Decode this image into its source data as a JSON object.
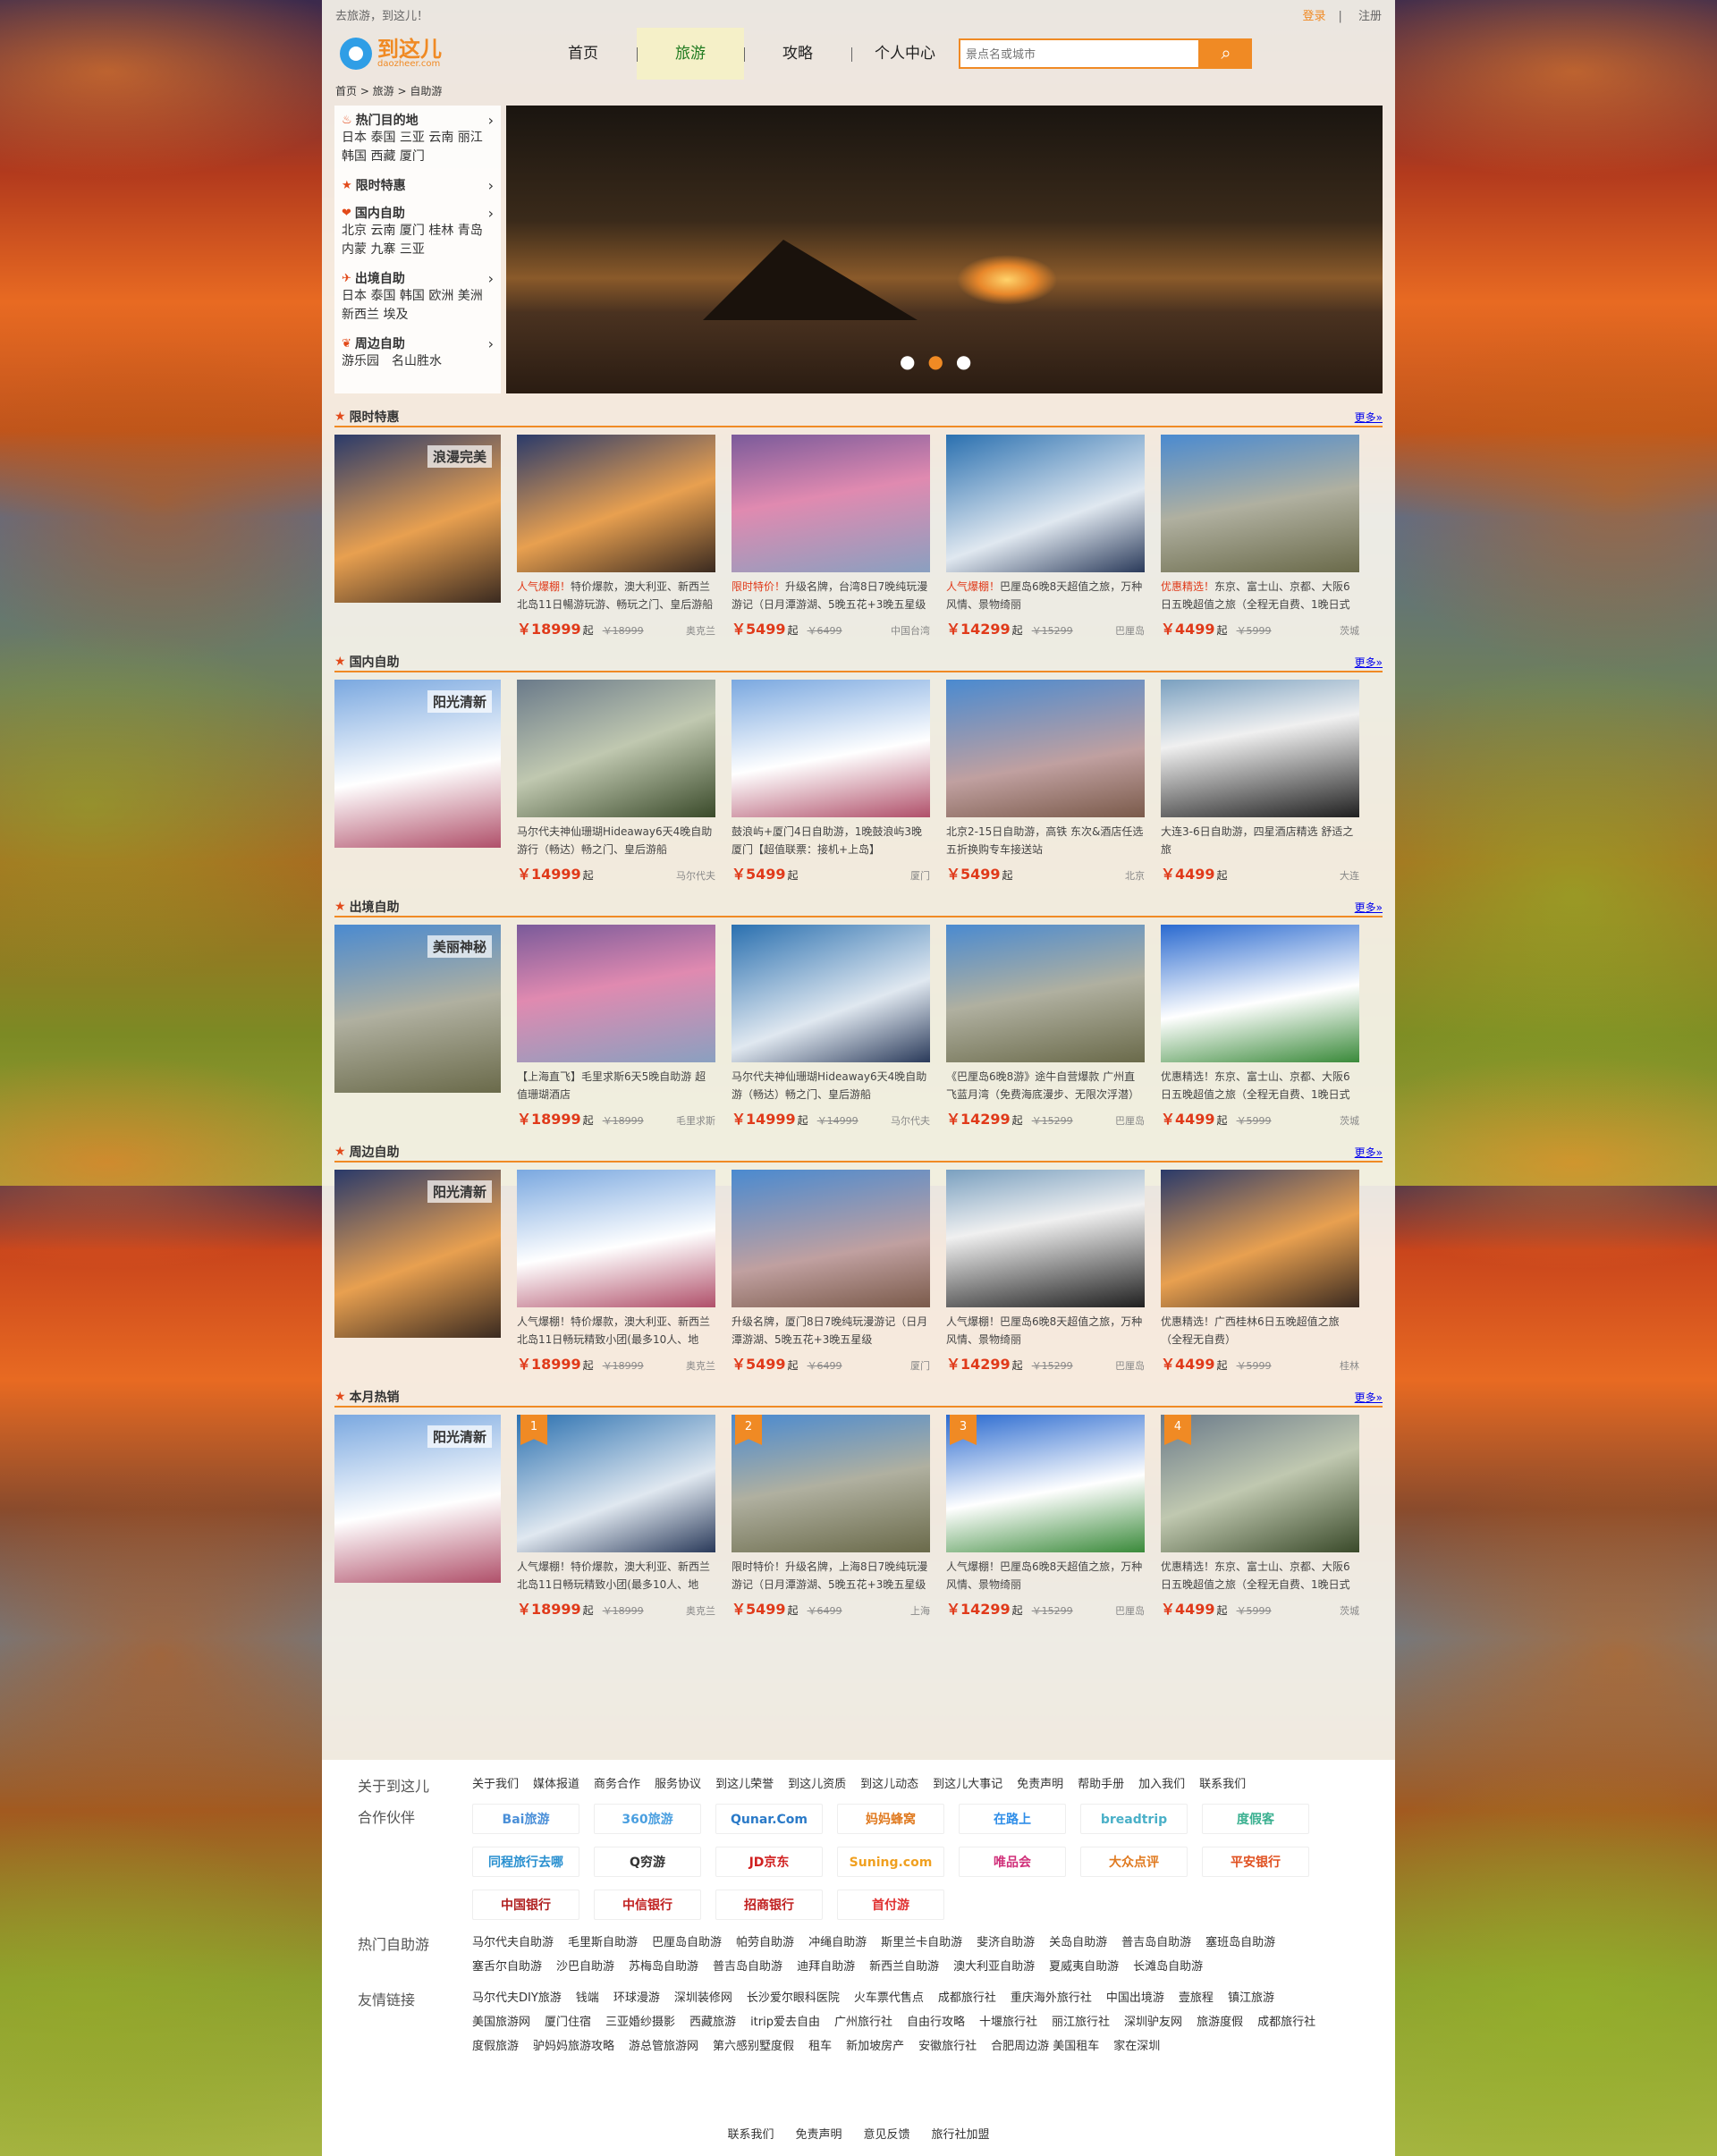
{
  "topbar": {
    "slogan": "去旅游，到这儿！",
    "login": "登录",
    "register": "注册"
  },
  "logo": {
    "cn": "到这儿",
    "en": "daozheer.com"
  },
  "nav": [
    "首页",
    "旅游",
    "攻略",
    "个人中心"
  ],
  "search": {
    "placeholder": "景点名或城市"
  },
  "crumb": "首页 > 旅游 > 自助游",
  "menu": [
    {
      "title": "热门目的地",
      "links": "日本 泰国 三亚 云南 丽江 韩国 西藏 厦门"
    },
    {
      "title": "限时特惠",
      "links": ""
    },
    {
      "title": "国内自助",
      "links": "北京 云南 厦门 桂林 青岛 内蒙 九寨 三亚"
    },
    {
      "title": "出境自助",
      "links": "日本 泰国 韩国 欧洲 美洲 新西兰 埃及"
    },
    {
      "title": "周边自助",
      "links": "游乐园　名山胜水"
    }
  ],
  "sections": [
    {
      "title": "限时特惠",
      "more": "更多»",
      "feat": "浪漫完美",
      "cards": [
        {
          "t_hl": "人气爆棚！",
          "t": "特价爆款，澳大利亚、新西兰北岛11日暢游玩游、畅玩之门、皇后游船",
          "price": "￥18999",
          "old": "￥18999",
          "place": "奥克兰"
        },
        {
          "t_hl": "限时特价！",
          "t": "升级名牌，台湾8日7晚纯玩漫游记（日月潭游湖、5晚五花+3晚五星级",
          "price": "￥5499",
          "old": "￥6499",
          "place": "中国台湾"
        },
        {
          "t_hl": "人气爆棚！",
          "t": "巴厘岛6晚8天超值之旅，万种风情、景物绮丽",
          "price": "￥14299",
          "old": "￥15299",
          "place": "巴厘岛"
        },
        {
          "t_hl": "优惠精选！",
          "t": "东京、富士山、京都、大阪6日五晚超值之旅（全程无自费、1晚日式",
          "price": "￥4499",
          "old": "￥5999",
          "place": "茨城"
        }
      ]
    },
    {
      "title": "国内自助",
      "more": "更多»",
      "feat": "阳光清新",
      "cards": [
        {
          "t_hl": "",
          "t": "马尔代夫神仙珊瑚Hideaway6天4晚自助游行（畅达）畅之门、皇后游船",
          "price": "￥14999",
          "old": "",
          "place": "马尔代夫"
        },
        {
          "t_hl": "",
          "t": "鼓浪屿+厦门4日自助游，1晚鼓浪屿3晚厦门【超值联票：接机+上岛】",
          "price": "￥5499",
          "old": "",
          "place": "厦门"
        },
        {
          "t_hl": "",
          "t": "北京2-15日自助游，高铁 东次&酒店任选五折换购专车接送站",
          "price": "￥5499",
          "old": "",
          "place": "北京"
        },
        {
          "t_hl": "",
          "t": "大连3-6日自助游，四星酒店精选 舒适之旅",
          "price": "￥4499",
          "old": "",
          "place": "大连"
        }
      ]
    },
    {
      "title": "出境自助",
      "more": "更多»",
      "feat": "美丽神秘",
      "cards": [
        {
          "t_hl": "",
          "t": "【上海直飞】毛里求斯6天5晚自助游 超值珊瑚酒店",
          "price": "￥18999",
          "old": "￥18999",
          "place": "毛里求斯"
        },
        {
          "t_hl": "",
          "t": "马尔代夫神仙珊瑚Hideaway6天4晚自助游（畅达）畅之门、皇后游船",
          "price": "￥14999",
          "old": "￥14999",
          "place": "马尔代夫"
        },
        {
          "t_hl": "",
          "t": "《巴厘岛6晚8游》途牛自营爆款 广州直飞蓝月湾（免费海底漫步、无限次浮潜）四",
          "price": "￥14299",
          "old": "￥15299",
          "place": "巴厘岛"
        },
        {
          "t_hl": "",
          "t": "优惠精选！东京、富士山、京都、大阪6日五晚超值之旅（全程无自费、1晚日式",
          "price": "￥4499",
          "old": "￥5999",
          "place": "茨城"
        }
      ]
    },
    {
      "title": "周边自助",
      "more": "更多»",
      "feat": "阳光清新",
      "cards": [
        {
          "t_hl": "",
          "t": "人气爆棚！特价爆款，澳大利亚、新西兰北岛11日畅玩精致小团(最多10人、地",
          "price": "￥18999",
          "old": "￥18999",
          "place": "奥克兰"
        },
        {
          "t_hl": "",
          "t": "升级名牌，厦门8日7晚纯玩漫游记（日月潭游湖、5晚五花+3晚五星级",
          "price": "￥5499",
          "old": "￥6499",
          "place": "厦门"
        },
        {
          "t_hl": "",
          "t": "人气爆棚！巴厘岛6晚8天超值之旅，万种风情、景物绮丽",
          "price": "￥14299",
          "old": "￥15299",
          "place": "巴厘岛"
        },
        {
          "t_hl": "",
          "t": "优惠精选！广西桂林6日五晚超值之旅（全程无自费）",
          "price": "￥4499",
          "old": "￥5999",
          "place": "桂林"
        }
      ]
    },
    {
      "title": "本月热销",
      "more": "更多»",
      "feat": "阳光清新",
      "cards": [
        {
          "rank": "1",
          "t_hl": "",
          "t": "人气爆棚！特价爆款，澳大利亚、新西兰北岛11日畅玩精致小团(最多10人、地",
          "price": "￥18999",
          "old": "￥18999",
          "place": "奥克兰"
        },
        {
          "rank": "2",
          "t_hl": "",
          "t": "限时特价！升级名牌，上海8日7晚纯玩漫游记（日月潭游湖、5晚五花+3晚五星级",
          "price": "￥5499",
          "old": "￥6499",
          "place": "上海"
        },
        {
          "rank": "3",
          "t_hl": "",
          "t": "人气爆棚！巴厘岛6晚8天超值之旅，万种风情、景物绮丽",
          "price": "￥14299",
          "old": "￥15299",
          "place": "巴厘岛"
        },
        {
          "rank": "4",
          "t_hl": "",
          "t": "优惠精选！东京、富士山、京都、大阪6日五晚超值之旅（全程无自费、1晚日式",
          "price": "￥4499",
          "old": "￥5999",
          "place": "茨城"
        }
      ]
    }
  ],
  "qi": "起",
  "footer": {
    "about_label": "关于到这儿",
    "about": [
      "关于我们",
      "媒体报道",
      "商务合作",
      "服务协议",
      "到这儿荣誉",
      "到这儿资质",
      "到这儿动态",
      "到这儿大事记",
      "免责声明",
      "帮助手册",
      "加入我们",
      "联系我们"
    ],
    "partners_label": "合作伙伴",
    "partners": [
      {
        "n": "Bai旅游",
        "c": "#4a8fd8"
      },
      {
        "n": "360旅游",
        "c": "#4a9fe0"
      },
      {
        "n": "Qunar.Com",
        "c": "#2a7ac8"
      },
      {
        "n": "妈妈蜂窝",
        "c": "#e07a20"
      },
      {
        "n": "在路上",
        "c": "#2f8ee8"
      },
      {
        "n": "breadtrip",
        "c": "#4ab0c8"
      },
      {
        "n": "度假客",
        "c": "#3ab090"
      },
      {
        "n": "同程旅行去哪",
        "c": "#2a90d0"
      },
      {
        "n": "Q穷游",
        "c": "#333333"
      },
      {
        "n": "JD京东",
        "c": "#d02020"
      },
      {
        "n": "Suning.com",
        "c": "#f0a020"
      },
      {
        "n": "唯品会",
        "c": "#d0307a"
      },
      {
        "n": "大众点评",
        "c": "#e07a20"
      },
      {
        "n": "平安银行",
        "c": "#e05020"
      },
      {
        "n": "中国银行",
        "c": "#b02020"
      },
      {
        "n": "中信银行",
        "c": "#c02020"
      },
      {
        "n": "招商银行",
        "c": "#c02020"
      },
      {
        "n": "首付游",
        "c": "#e03030"
      }
    ],
    "hot_label": "热门自助游",
    "hot": [
      "马尔代夫自助游",
      "毛里斯自助游",
      "巴厘岛自助游",
      "帕劳自助游",
      "冲绳自助游",
      "斯里兰卡自助游",
      "斐济自助游",
      "关岛自助游",
      "普吉岛自助游",
      "塞班岛自助游",
      "塞舌尔自助游",
      "沙巴自助游",
      "苏梅岛自助游",
      "普吉岛自助游",
      "迪拜自助游",
      "新西兰自助游",
      "澳大利亚自助游",
      "夏威夷自助游",
      "长滩岛自助游"
    ],
    "friends_label": "友情链接",
    "friends": [
      "马尔代夫DIY旅游",
      "钱端",
      "环球漫游",
      "深圳装修网",
      "长沙爱尔眼科医院",
      "火车票代售点",
      "成都旅行社",
      "重庆海外旅行社",
      "中国出境游",
      "壹旅程",
      "镇江旅游",
      "美国旅游网",
      "厦门住宿",
      "三亚婚纱摄影",
      "西藏旅游",
      "itrip爱去自由",
      "广州旅行社",
      "自由行攻略",
      "十堰旅行社",
      "丽江旅行社",
      "深圳驴友网",
      "旅游度假",
      "成都旅行社",
      "度假旅游",
      "驴妈妈旅游攻略",
      "游总管旅游网",
      "第六感别墅度假",
      "租车",
      "新加坡房产",
      "安徽旅行社",
      "合肥周边游 美国租车",
      "家在深圳"
    ],
    "bottom": [
      "联系我们",
      "免责声明",
      "意见反馈",
      "旅行社加盟"
    ]
  },
  "colors": {
    "accent": "#f08a24",
    "price": "#e03a1a"
  }
}
